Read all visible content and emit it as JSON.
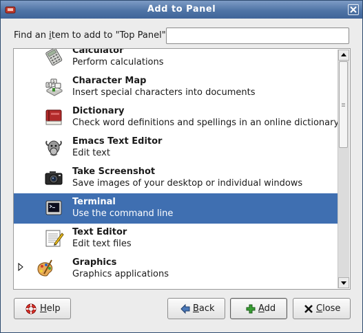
{
  "window": {
    "title": "Add to Panel"
  },
  "search": {
    "label_pre": "Find an ",
    "label_mnemonic": "i",
    "label_post": "tem to add to \"Top Panel\":",
    "value": ""
  },
  "items": [
    {
      "name": "Calculator",
      "desc": "Perform calculations",
      "icon": "calculator-icon"
    },
    {
      "name": "Character Map",
      "desc": "Insert special characters into documents",
      "icon": "character-map-icon"
    },
    {
      "name": "Dictionary",
      "desc": "Check word definitions and spellings in an online dictionary",
      "icon": "dictionary-icon"
    },
    {
      "name": "Emacs Text Editor",
      "desc": "Edit text",
      "icon": "emacs-gnu-icon"
    },
    {
      "name": "Take Screenshot",
      "desc": "Save images of your desktop or individual windows",
      "icon": "camera-icon"
    },
    {
      "name": "Terminal",
      "desc": "Use the command line",
      "icon": "terminal-icon",
      "selected": true
    },
    {
      "name": "Text Editor",
      "desc": "Edit text files",
      "icon": "text-editor-icon"
    },
    {
      "name": "Graphics",
      "desc": "Graphics applications",
      "icon": "graphics-palette-icon",
      "category": true
    }
  ],
  "buttons": {
    "help": {
      "mnemonic": "H",
      "rest": "elp"
    },
    "back": {
      "mnemonic": "B",
      "rest": "ack"
    },
    "add": {
      "mnemonic": "A",
      "rest": "dd"
    },
    "close": {
      "mnemonic": "C",
      "rest": "lose"
    }
  },
  "colors": {
    "titlebar": "#4f74a6",
    "selection": "#3f6fb1"
  }
}
